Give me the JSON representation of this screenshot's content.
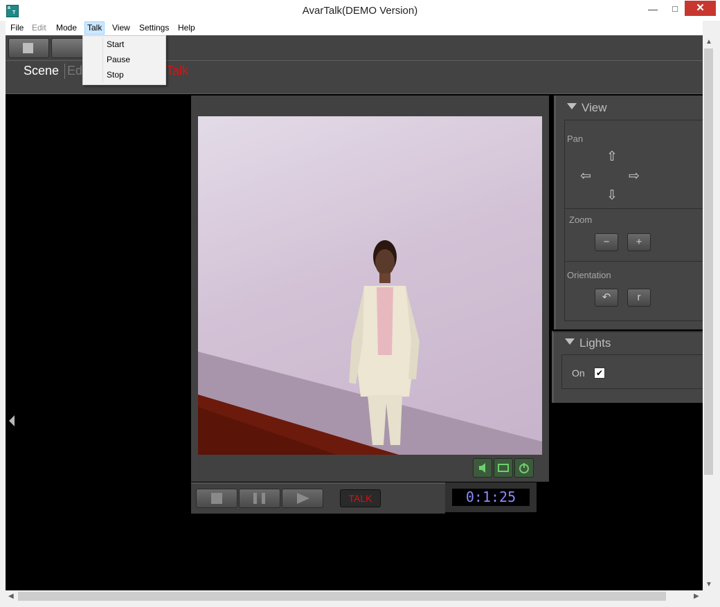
{
  "window": {
    "title": "AvarTalk(DEMO Version)",
    "min": "—",
    "max": "□",
    "close": "✕"
  },
  "menu": [
    "File",
    "Edit",
    "Mode",
    "Talk",
    "View",
    "Settings",
    "Help"
  ],
  "talk_menu": [
    "Start",
    "Pause",
    "Stop"
  ],
  "tabs": {
    "scene": "Scene",
    "edit": "Ed",
    "talk": "Talk"
  },
  "player": {
    "talk_label": "TALK",
    "time": "0:1:25"
  },
  "view_panel": {
    "title": "View",
    "pan": "Pan",
    "zoom": "Zoom",
    "orientation": "Orientation",
    "zoom_out": "−",
    "zoom_in": "+",
    "rotate_left": "↶",
    "rotate_right": "r"
  },
  "lights_panel": {
    "title": "Lights",
    "on_label": "On",
    "on_checked": "✔"
  },
  "colors": {
    "accent_red": "#e01010",
    "time_blue": "#8b8bff",
    "panel": "#454545"
  }
}
